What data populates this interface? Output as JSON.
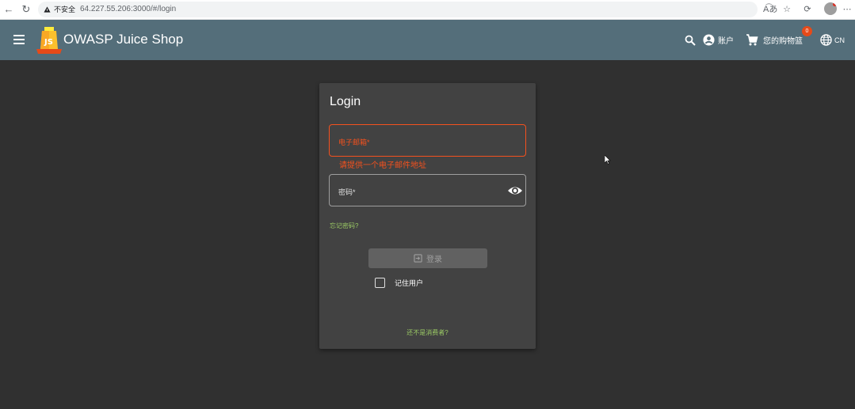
{
  "browser": {
    "insecure_label": "不安全",
    "url": "64.227.55.206:3000/#/login"
  },
  "toolbar": {
    "app_title": "OWASP Juice Shop",
    "account_label": "账户",
    "basket_label": "您的购物篮",
    "basket_count": "0",
    "language_label": "CN"
  },
  "login": {
    "title": "Login",
    "email_label": "电子邮箱*",
    "email_error": "请提供一个电子邮件地址",
    "password_label": "密码*",
    "forgot_password": "忘记密码?",
    "login_button": "登录",
    "remember_me": "记住用户",
    "register_link": "还不是消费者?"
  },
  "colors": {
    "toolbar": "#546e7a",
    "background": "#303030",
    "card": "#424242",
    "error": "#f4511e",
    "link": "#9ccc65"
  }
}
